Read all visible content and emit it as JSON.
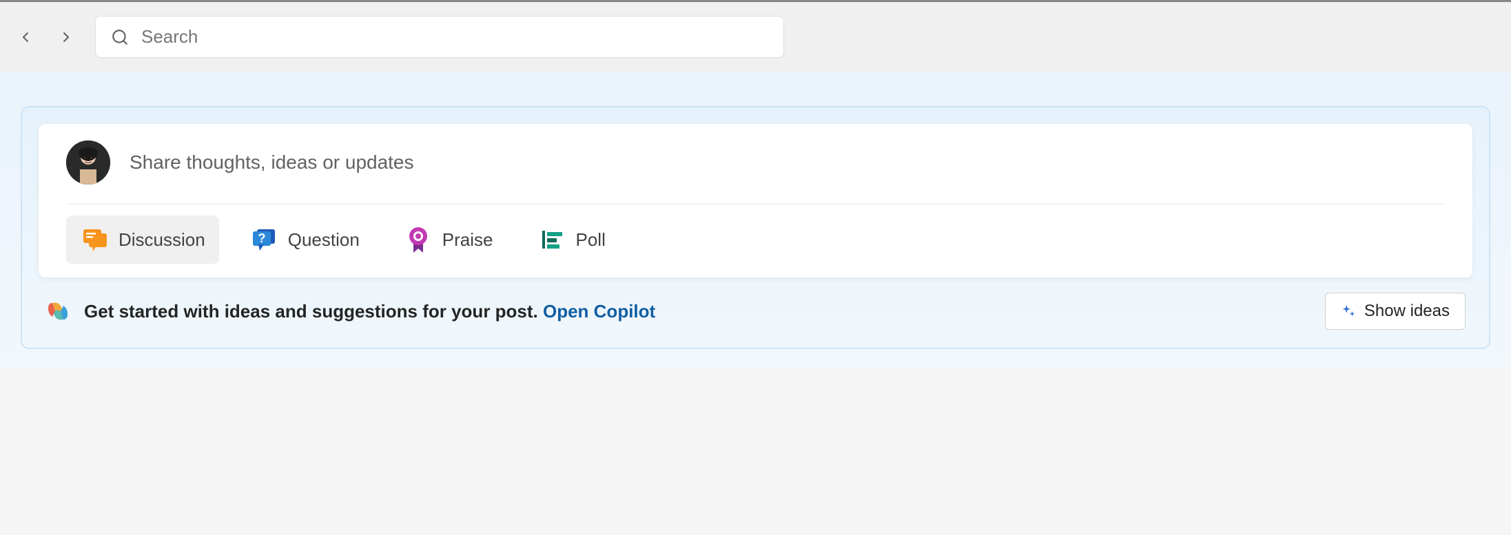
{
  "header": {
    "search_placeholder": "Search"
  },
  "compose": {
    "prompt": "Share thoughts, ideas or updates",
    "post_types": {
      "discussion": "Discussion",
      "question": "Question",
      "praise": "Praise",
      "poll": "Poll"
    }
  },
  "copilot": {
    "hint_text": "Get started with ideas and suggestions for your post. ",
    "link_text": "Open Copilot",
    "show_ideas_label": "Show ideas"
  }
}
